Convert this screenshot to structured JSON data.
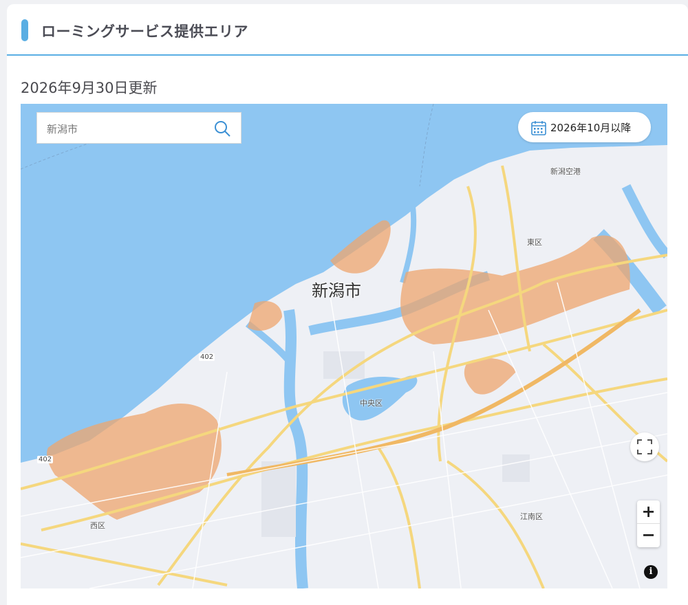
{
  "header": {
    "title": "ローミングサービス提供エリア"
  },
  "updated_text": "2026年9月30日更新",
  "map": {
    "search_value": "新潟市",
    "date_button_label": "2026年10月以降",
    "city_label": "新潟市",
    "labels": {
      "airport": "新潟空港",
      "higashi": "東区",
      "chuo": "中央区",
      "nishi": "西区",
      "konan": "江南区"
    },
    "route_402_a": "402",
    "route_402_b": "402",
    "zoom_in": "+",
    "zoom_out": "−",
    "info": "i",
    "colors": {
      "sea": "#8ec6f2",
      "coverage": "#eda66d",
      "road": "#f5d77e",
      "land": "#eef0f5"
    }
  }
}
